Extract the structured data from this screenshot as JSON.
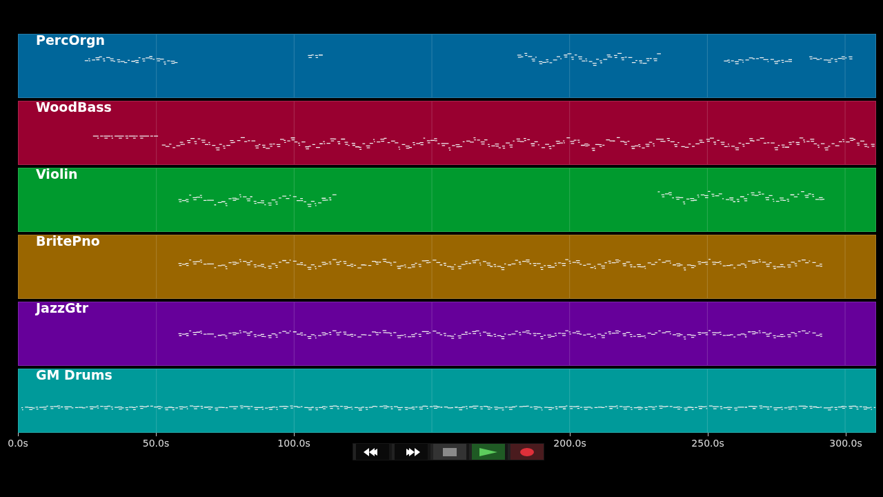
{
  "tracks": [
    {
      "name": "PercOrgn",
      "color": "#00669a"
    },
    {
      "name": "WoodBass",
      "color": "#990030"
    },
    {
      "name": "Violin",
      "color": "#009a2e"
    },
    {
      "name": "BritePno",
      "color": "#9a6600"
    },
    {
      "name": "JazzGtr",
      "color": "#66009a"
    },
    {
      "name": "GM Drums",
      "color": "#009a9a"
    }
  ],
  "time_axis": {
    "ticks": [
      "0.0s",
      "50.0s",
      "100.0s",
      "200.0s",
      "250.0s",
      "300.0s"
    ]
  },
  "transport": [
    {
      "kind": "rewind"
    },
    {
      "kind": "forward"
    },
    {
      "kind": "stop"
    },
    {
      "kind": "play"
    },
    {
      "kind": "record"
    }
  ]
}
